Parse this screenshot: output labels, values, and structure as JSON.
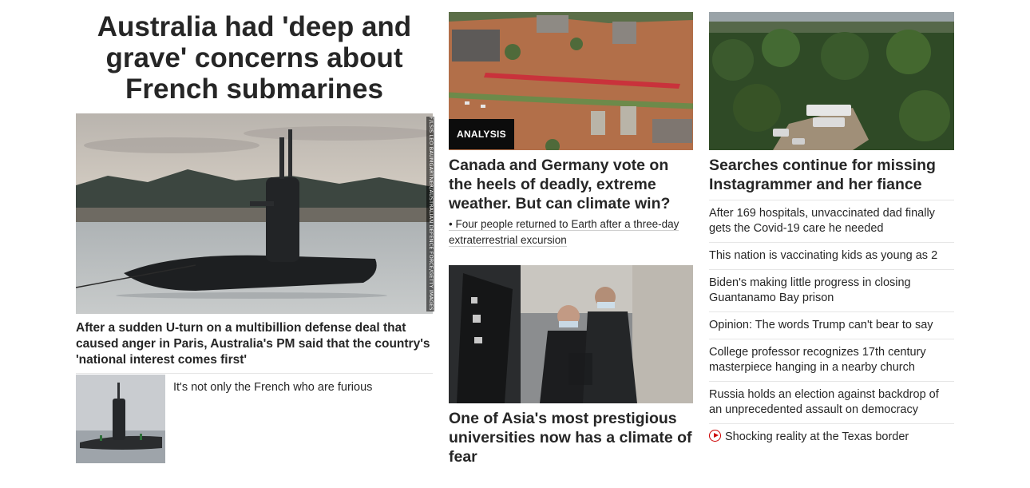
{
  "left": {
    "headline": "Australia had 'deep and grave' concerns about French submarines",
    "hero_credit": "F/LSIS LEO BAUMGARTNER/AUSTRALIAN DEFENCE FORCE/GETTY IMAGES",
    "summary": "After a sudden U-turn on a multibillion defense deal that caused anger in Paris, Australia's PM said that the country's 'national interest comes first'",
    "sub_story": "It's not only the French who are furious"
  },
  "middle": {
    "badge": "ANALYSIS",
    "story1_headline": "Canada and Germany vote on the heels of deadly, extreme weather. But can climate win?",
    "story1_bullet": "• Four people returned to Earth after a three-day extraterrestrial excursion",
    "story2_headline": "One of Asia's most prestigious universities now has a climate of fear"
  },
  "right": {
    "headline": "Searches continue for missing Instagrammer and her fiance",
    "links": [
      "After 169 hospitals, unvaccinated dad finally gets the Covid-19 care he needed",
      "This nation is vaccinating kids as young as 2",
      "Biden's making little progress in closing Guantanamo Bay prison",
      "Opinion: The words Trump can't bear to say",
      "College professor recognizes 17th century masterpiece hanging in a nearby church",
      "Russia holds an election against backdrop of an unprecedented assault on democracy"
    ],
    "video_link": "Shocking reality at the Texas border",
    "video_icon": "play-circle-icon"
  },
  "colors": {
    "text": "#262626",
    "badge_bg": "#0c0c0c",
    "video_accent": "#cc0000",
    "divider": "#e6e6e6"
  }
}
